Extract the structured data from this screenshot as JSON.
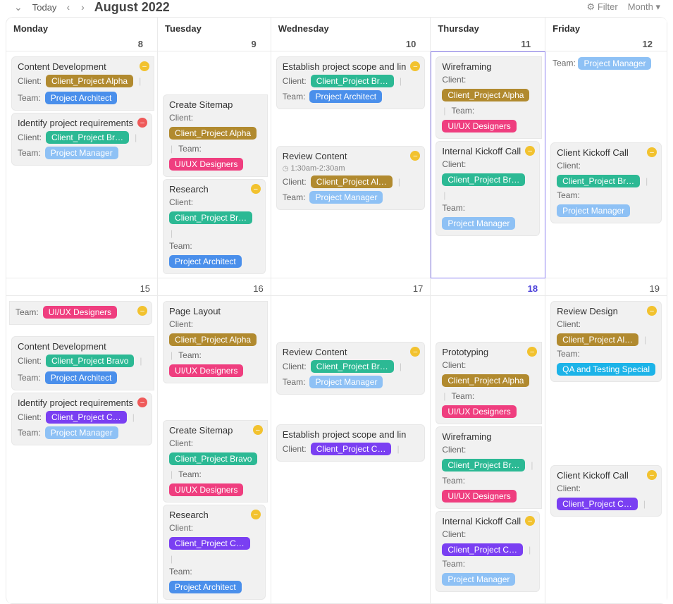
{
  "toolbar": {
    "today": "Today",
    "title": "August 2022",
    "filter": "Filter",
    "view": "Month"
  },
  "day_headers": [
    "Monday",
    "Tuesday",
    "Wednesday",
    "Thursday",
    "Friday"
  ],
  "week1_nums": [
    "8",
    "9",
    "10",
    "11",
    "12"
  ],
  "week2_nums": [
    "15",
    "16",
    "17",
    "18",
    "19"
  ],
  "labels": {
    "client": "Client:",
    "team": "Team:"
  },
  "clients": {
    "alpha": "Client_Project Alpha",
    "alpha_short": "Client_Project Al…",
    "bravo": "Client_Project Bravo",
    "bravo_short": "Client_Project Br…",
    "charlie": "Client_Project C…"
  },
  "teams": {
    "architect": "Project Architect",
    "pm": "Project Manager",
    "ux": "UI/UX Designers",
    "qa": "QA and Testing Special"
  },
  "titles": {
    "content_dev": "Content Development",
    "identify_req": "Identify project requirements",
    "create_sitemap": "Create Sitemap",
    "research": "Research",
    "establish_scope": "Establish project scope and lin",
    "review_content": "Review Content",
    "wireframing": "Wireframing",
    "internal_kickoff": "Internal Kickoff Call",
    "client_kickoff": "Client Kickoff Call",
    "page_layout": "Page Layout",
    "review_design": "Review Design",
    "prototyping": "Prototyping"
  },
  "times": {
    "review_content": "1:30am-2:30am"
  },
  "r1c5_text": "Team:"
}
